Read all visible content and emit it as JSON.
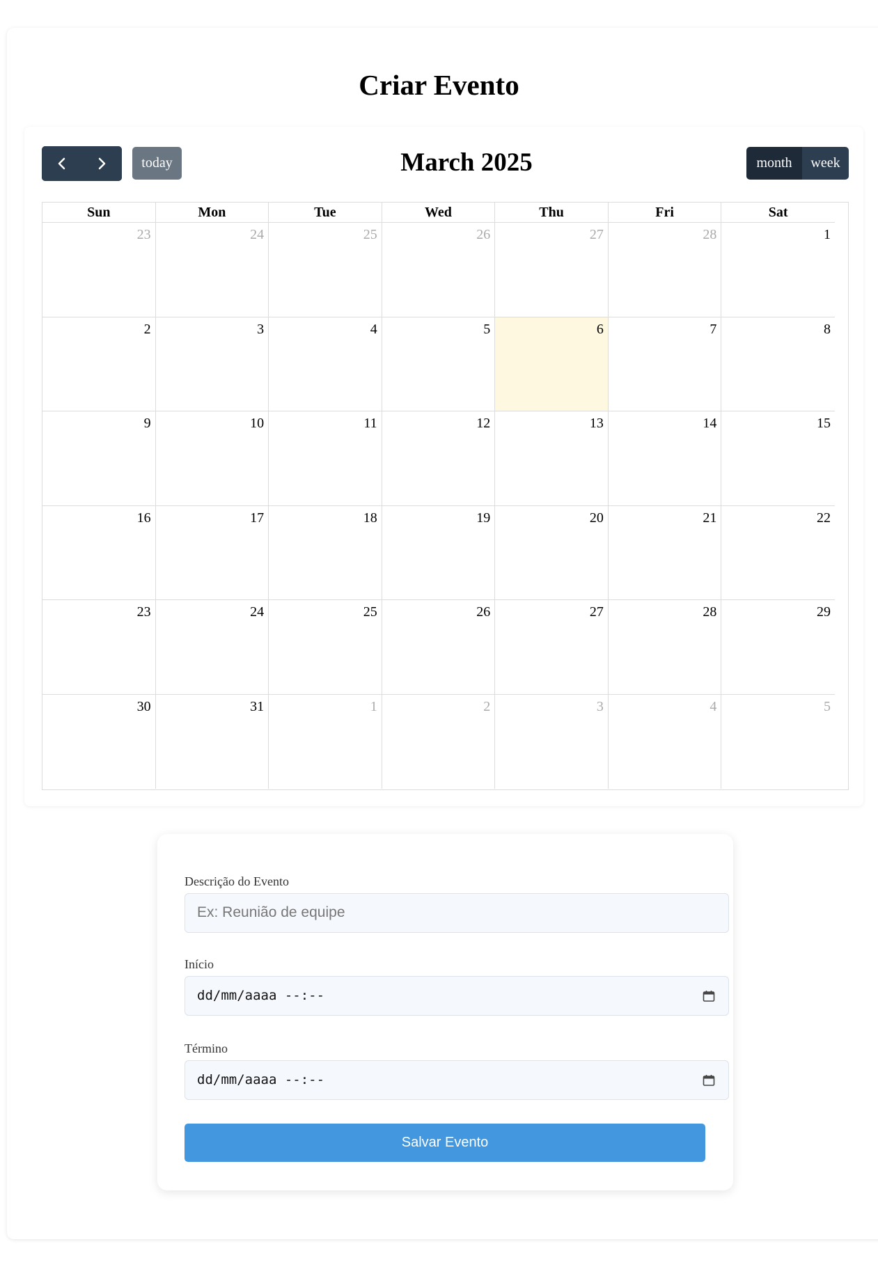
{
  "page": {
    "title": "Criar Evento"
  },
  "calendar": {
    "title": "March 2025",
    "prev_icon": "chevron-left-icon",
    "next_icon": "chevron-right-icon",
    "today_label": "today",
    "views": [
      {
        "label": "month",
        "active": true
      },
      {
        "label": "week",
        "active": false
      }
    ],
    "weekdays": [
      "Sun",
      "Mon",
      "Tue",
      "Wed",
      "Thu",
      "Fri",
      "Sat"
    ],
    "weeks": [
      [
        {
          "day": "23",
          "other": true
        },
        {
          "day": "24",
          "other": true
        },
        {
          "day": "25",
          "other": true
        },
        {
          "day": "26",
          "other": true
        },
        {
          "day": "27",
          "other": true
        },
        {
          "day": "28",
          "other": true
        },
        {
          "day": "1"
        }
      ],
      [
        {
          "day": "2"
        },
        {
          "day": "3"
        },
        {
          "day": "4"
        },
        {
          "day": "5"
        },
        {
          "day": "6",
          "today": true
        },
        {
          "day": "7"
        },
        {
          "day": "8"
        }
      ],
      [
        {
          "day": "9"
        },
        {
          "day": "10"
        },
        {
          "day": "11"
        },
        {
          "day": "12"
        },
        {
          "day": "13"
        },
        {
          "day": "14"
        },
        {
          "day": "15"
        }
      ],
      [
        {
          "day": "16"
        },
        {
          "day": "17"
        },
        {
          "day": "18"
        },
        {
          "day": "19"
        },
        {
          "day": "20"
        },
        {
          "day": "21"
        },
        {
          "day": "22"
        }
      ],
      [
        {
          "day": "23"
        },
        {
          "day": "24"
        },
        {
          "day": "25"
        },
        {
          "day": "26"
        },
        {
          "day": "27"
        },
        {
          "day": "28"
        },
        {
          "day": "29"
        }
      ],
      [
        {
          "day": "30"
        },
        {
          "day": "31"
        },
        {
          "day": "1",
          "other": true
        },
        {
          "day": "2",
          "other": true
        },
        {
          "day": "3",
          "other": true
        },
        {
          "day": "4",
          "other": true
        },
        {
          "day": "5",
          "other": true
        }
      ]
    ],
    "colors": {
      "today_bg": "#fdf8df",
      "button_dark": "#2c3e50",
      "button_active": "#1e2a38",
      "today_button": "#6b7683"
    }
  },
  "form": {
    "description": {
      "label": "Descrição do Evento",
      "placeholder": "Ex: Reunião de equipe"
    },
    "start": {
      "label": "Início",
      "value": "dd/mm/aaaa --:--",
      "icon": "calendar-icon"
    },
    "end": {
      "label": "Término",
      "value": "dd/mm/aaaa --:--",
      "icon": "calendar-icon"
    },
    "save_label": "Salvar Evento",
    "colors": {
      "save_button": "#4397de"
    }
  }
}
